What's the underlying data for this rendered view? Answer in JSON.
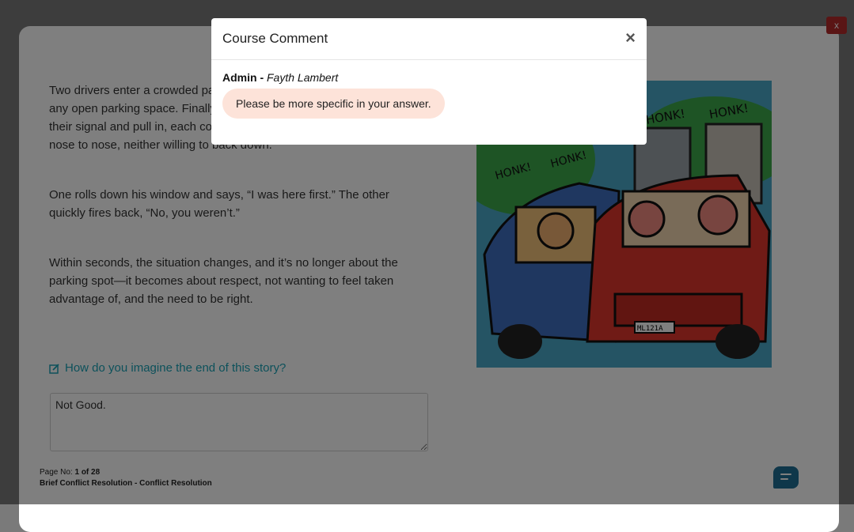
{
  "story": {
    "paragraphs": [
      "Two drivers enter a crowded parking lot at the same time, scanning for any open parking space. Finally, one opens up. Instantly, both turn on their signal and pull in, each convinced they got there first. They stop nose to nose, neither willing to back down.",
      "One rolls down his window and says, “I was here first.” The other quickly fires back, “No, you weren’t.”",
      "Within seconds, the situation changes, and it’s no longer about the parking spot—it becomes about respect, not wanting to feel taken advantage of, and the need to be right."
    ],
    "question": "How do you imagine the end of this story?",
    "answer": "Not Good."
  },
  "illustration": {
    "honk_text": [
      "HONK!",
      "HONK!",
      "HONK!",
      "HONK!"
    ],
    "plate": "ML121A"
  },
  "footer": {
    "page_label": "Page No:",
    "page_value": "1 of 28",
    "course": "Brief Conflict Resolution - Conflict Resolution"
  },
  "close_button": "x",
  "modal": {
    "title": "Course Comment",
    "close": "×",
    "role": "Admin -",
    "author": "Fayth Lambert",
    "comment": "Please be more specific in your answer."
  },
  "colors": {
    "accent": "#1aa3b6",
    "danger": "#b52a2a",
    "bubble": "#fde3d9",
    "chat": "#1f6f94"
  }
}
